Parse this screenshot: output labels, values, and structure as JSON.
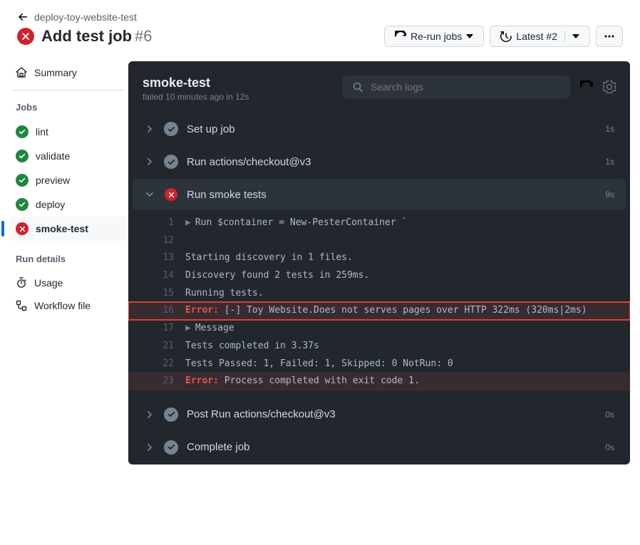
{
  "header": {
    "back_label": "deploy-toy-website-test",
    "title": "Add test job",
    "run_number": "#6",
    "rerun_label": "Re-run jobs",
    "latest_label": "Latest #2"
  },
  "sidebar": {
    "summary_label": "Summary",
    "jobs_heading": "Jobs",
    "jobs": [
      {
        "label": "lint",
        "status": "success"
      },
      {
        "label": "validate",
        "status": "success"
      },
      {
        "label": "preview",
        "status": "success"
      },
      {
        "label": "deploy",
        "status": "success"
      },
      {
        "label": "smoke-test",
        "status": "fail"
      }
    ],
    "details_heading": "Run details",
    "usage_label": "Usage",
    "workflow_file_label": "Workflow file"
  },
  "main": {
    "job_title": "smoke-test",
    "job_subtitle": "failed 10 minutes ago in 12s",
    "search_placeholder": "Search logs",
    "steps": [
      {
        "name": "Set up job",
        "duration": "1s",
        "status": "success",
        "expanded": false
      },
      {
        "name": "Run actions/checkout@v3",
        "duration": "1s",
        "status": "success",
        "expanded": false
      },
      {
        "name": "Run smoke tests",
        "duration": "9s",
        "status": "fail",
        "expanded": true
      },
      {
        "name": "Post Run actions/checkout@v3",
        "duration": "0s",
        "status": "success",
        "expanded": false
      },
      {
        "name": "Complete job",
        "duration": "0s",
        "status": "success",
        "expanded": false
      }
    ],
    "log_lines": [
      {
        "n": 1,
        "text": "Run $container = New-PesterContainer `",
        "caret": true
      },
      {
        "n": 12,
        "text": ""
      },
      {
        "n": 13,
        "text": "Starting discovery in 1 files."
      },
      {
        "n": 14,
        "text": "Discovery found 2 tests in 259ms."
      },
      {
        "n": 15,
        "text": "Running tests."
      },
      {
        "n": 16,
        "text": "[-] Toy Website.Does not serves pages over HTTP 322ms (320ms|2ms)",
        "error": true,
        "highlight": true
      },
      {
        "n": 17,
        "text": "Message",
        "caret": true
      },
      {
        "n": 21,
        "text": "Tests completed in 3.37s"
      },
      {
        "n": 22,
        "text": "Tests Passed: 1, Failed: 1, Skipped: 0 NotRun: 0"
      },
      {
        "n": 23,
        "text": "Process completed with exit code 1.",
        "error": true
      }
    ]
  }
}
